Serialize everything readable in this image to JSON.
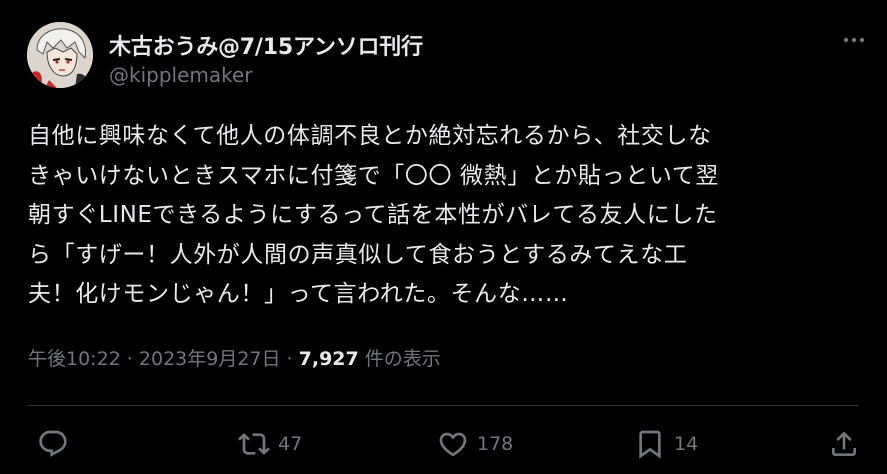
{
  "author": {
    "display_name": "木古おうみ@7/15アンソロ刊行",
    "handle": "@kipplemaker"
  },
  "tweet": {
    "lines": [
      "自他に興味なくて他人の体調不良とか絶対忘れるから、社交しな",
      "きゃいけないときスマホに付箋で「〇〇 微熱」とか貼っといて翌",
      "朝すぐLINEできるようにするって話を本性がバレてる友人にした",
      "ら「すげー！人外が人間の声真似して食おうとするみてえな工",
      "夫！化けモンじゃん！」って言われた。そんな……"
    ]
  },
  "meta": {
    "time": "午後10:22",
    "separator1": " · ",
    "date": "2023年9月27日",
    "separator2": " · ",
    "views_count": "7,927",
    "views_label": " 件の表示"
  },
  "actions": {
    "reply_count": "",
    "retweet_count": "47",
    "like_count": "178",
    "bookmark_count": "14"
  },
  "icons": {
    "more": "more-icon",
    "reply": "reply-icon",
    "retweet": "retweet-icon",
    "like": "heart-icon",
    "bookmark": "bookmark-icon",
    "share": "share-icon"
  },
  "colors": {
    "background": "#000000",
    "text": "#e7e9ea",
    "secondary": "#71767b",
    "divider": "#2f3336"
  }
}
